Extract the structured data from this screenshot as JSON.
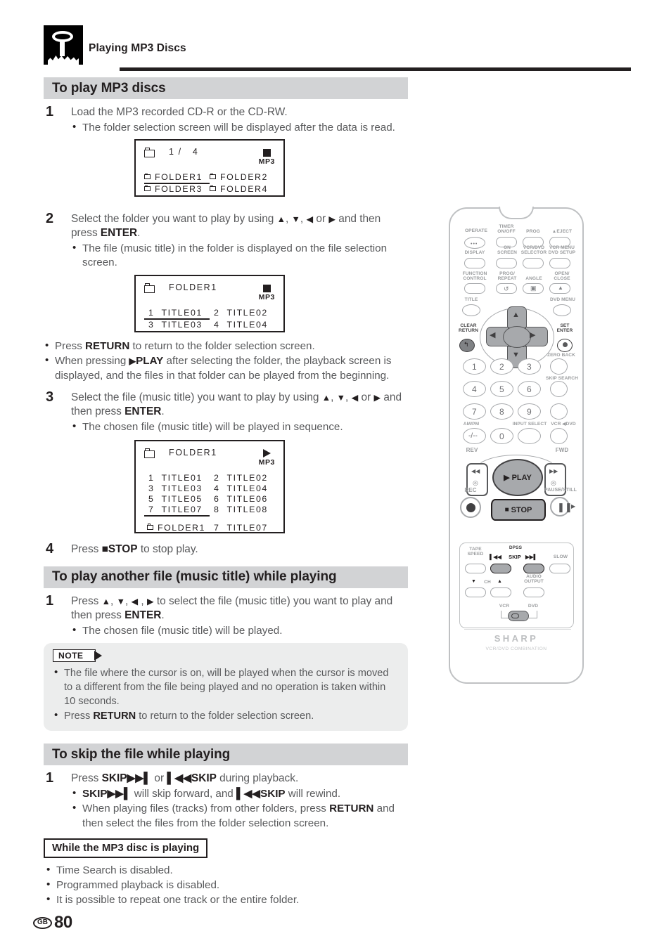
{
  "header": {
    "title": "Playing MP3 Discs",
    "icon": "mp3-disc-icon"
  },
  "sections": {
    "play_mp3": {
      "title": "To play MP3 discs",
      "steps": [
        {
          "number": "1",
          "text": "Load the MP3 recorded CD-R or the CD-RW.",
          "bullets": [
            "The folder selection screen will be displayed after the data is read."
          ]
        },
        {
          "number": "2",
          "text_a": "Select the folder you want to play by using ",
          "text_b": ", ",
          "text_c": ", ",
          "text_d": " or ",
          "text_e": " and then press ",
          "enter": "ENTER",
          "text_f": ".",
          "bullets": [
            "The file (music title) in the folder is displayed on the file selection screen."
          ],
          "bullets_after": [
            "Press RETURN to return to the folder selection screen.",
            "When pressing ▶PLAY after selecting the folder, the playback screen is displayed, and the files in that folder can be played from the beginning."
          ]
        },
        {
          "number": "3",
          "text_a": "Select the file (music title) you want to play by using ",
          "text_e": " and then press ",
          "enter": "ENTER",
          "text_f": ".",
          "bullets": [
            "The chosen file (music title) will be played in sequence."
          ]
        },
        {
          "number": "4",
          "text_a": "Press ",
          "stop": "STOP",
          "text_f": " to stop play."
        }
      ]
    },
    "play_another": {
      "title": "To play another file (music title) while playing",
      "step_number": "1",
      "text_a": "Press ",
      "text_e": " to select the file (music title) you want to play and then press ",
      "enter": "ENTER",
      "text_f": ".",
      "bullet": "The chosen file (music title) will be played."
    },
    "note": {
      "label": "NOTE",
      "items_html": [
        "The file where the cursor is on, will be played when the cursor is moved to a different from the file being played and no operation is taken within 10 seconds.",
        "Press RETURN to return to the folder selection screen."
      ],
      "item1_text": "The file where the cursor is on, will be played when the cursor is moved to a different from the file being played and no operation is taken within 10 seconds.",
      "item2_pre": "Press ",
      "item2_bold": "RETURN",
      "item2_post": " to return to the folder selection screen."
    },
    "skip_file": {
      "title": "To skip the file while playing",
      "step_number": "1",
      "line1_pre": "Press ",
      "line1_skip_fwd": "SKIP",
      "line1_mid": " or ",
      "line1_skip_rev": "SKIP",
      "line1_post": " during playback.",
      "bullet1_a": "SKIP",
      "bullet1_b": " will skip forward, and ",
      "bullet1_c": "SKIP",
      "bullet1_d": " will rewind.",
      "bullet2_pre": "When playing files (tracks) from other folders, press ",
      "bullet2_bold": "RETURN",
      "bullet2_post": " and then select the files from the folder selection screen."
    },
    "while_playing": {
      "title": "While the MP3 disc is playing",
      "items": [
        "Time Search is disabled.",
        "Programmed playback is disabled.",
        "It is possible to repeat one track or the entire folder."
      ]
    }
  },
  "osd_screens": [
    {
      "name": "folder-selection-screen",
      "header_label": "1 /   4",
      "status_icon": "stop-square",
      "format": "MP3",
      "rows": [
        [
          {
            "num": "",
            "label": "FOLDER1",
            "folder": true,
            "selected": true
          },
          {
            "num": "",
            "label": "FOLDER2",
            "folder": true,
            "selected": false
          }
        ],
        [
          {
            "num": "",
            "label": "FOLDER3",
            "folder": true,
            "selected": false
          },
          {
            "num": "",
            "label": "FOLDER4",
            "folder": true,
            "selected": false
          }
        ]
      ]
    },
    {
      "name": "file-selection-screen",
      "header_label": "FOLDER1",
      "status_icon": "stop-square",
      "format": "MP3",
      "rows": [
        [
          {
            "num": "1",
            "label": "TITLE01",
            "selected": true
          },
          {
            "num": "2",
            "label": "TITLE02",
            "selected": false
          }
        ],
        [
          {
            "num": "3",
            "label": "TITLE03",
            "selected": false
          },
          {
            "num": "4",
            "label": "TITLE04",
            "selected": false
          }
        ]
      ]
    },
    {
      "name": "playback-screen",
      "header_label": "FOLDER1",
      "status_icon": "play-triangle",
      "format": "MP3",
      "rows": [
        [
          {
            "num": "1",
            "label": "TITLE01",
            "selected": false
          },
          {
            "num": "2",
            "label": "TITLE02",
            "selected": false
          }
        ],
        [
          {
            "num": "3",
            "label": "TITLE03",
            "selected": false
          },
          {
            "num": "4",
            "label": "TITLE04",
            "selected": false
          }
        ],
        [
          {
            "num": "5",
            "label": "TITLE05",
            "selected": false
          },
          {
            "num": "6",
            "label": "TITLE06",
            "selected": false
          }
        ],
        [
          {
            "num": "7",
            "label": "TITLE07",
            "selected": true
          },
          {
            "num": "8",
            "label": "TITLE08",
            "selected": false
          }
        ]
      ],
      "footer": [
        {
          "num": "",
          "label": "FOLDER1",
          "folder": true
        },
        {
          "num": "7",
          "label": "TITLE07"
        }
      ]
    }
  ],
  "remote": {
    "brand": "SHARP",
    "model_line": "VCR/DVD COMBINATION",
    "labels": {
      "operate": "OPERATE",
      "timer_on_off": "TIMER\nON/OFF",
      "prog": "PROG",
      "eject": "▲EJECT",
      "display": "DISPLAY",
      "on_screen": "ON\nSCREEN",
      "vcr_dvd_selector": "VCR/DVD\nSELECTOR",
      "vcr_menu_dvd_setup": "VCR MENU\nDVD SETUP",
      "function_control": "FUNCTION\nCONTROL",
      "prog_repeat": "PROG/\nREPEAT",
      "angle": "ANGLE",
      "open_close": "OPEN/\nCLOSE",
      "title": "TITLE",
      "dvd_menu": "DVD MENU",
      "clear_return": "CLEAR\nRETURN",
      "set_enter": "SET\nENTER",
      "zero_back": "ZERO BACK",
      "skip_search": "SKIP SEARCH",
      "am_pm": "AM/PM",
      "input_select": "INPUT SELECT",
      "vcr_dvd": "VCR ◀DVD",
      "rev": "REV",
      "fwd": "FWD",
      "rec": "REC",
      "pause_still": "PAUSE/STILL",
      "play": "PLAY",
      "stop": "STOP",
      "tape_speed": "TAPE\nSPEED",
      "dpss": "DPSS",
      "skip": "SKIP",
      "slow": "SLOW",
      "ch": "CH",
      "audio_output": "AUDIO\nOUTPUT",
      "vcr": "VCR",
      "dvd": "DVD"
    },
    "keypad": [
      "1",
      "2",
      "3",
      "4",
      "5",
      "6",
      "7",
      "8",
      "9",
      "-/--",
      "0"
    ]
  },
  "footer": {
    "region": "GB",
    "page_number": "80"
  },
  "colors": {
    "section_bar": "#d2d3d5",
    "note_bg": "#eceded",
    "body_text": "#58595b",
    "heading": "#231f20"
  }
}
